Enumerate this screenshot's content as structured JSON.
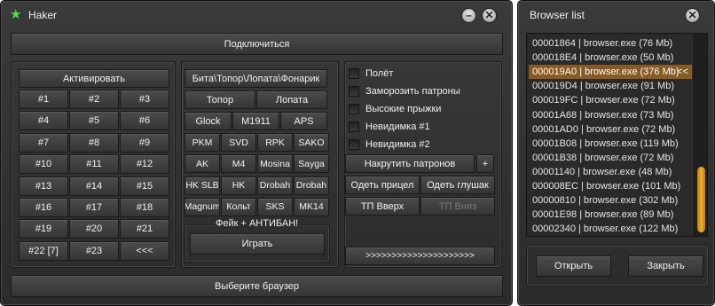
{
  "main_window": {
    "title": "Haker",
    "minimize_glyph": "–",
    "close_glyph": "✕",
    "connect_label": "Подключиться",
    "choose_browser_label": "Выберите браузер"
  },
  "left_panel": {
    "activate_label": "Активировать",
    "numbers": [
      "#1",
      "#2",
      "#3",
      "#4",
      "#5",
      "#6",
      "#7",
      "#8",
      "#9",
      "#10",
      "#11",
      "#12",
      "#13",
      "#14",
      "#15",
      "#16",
      "#17",
      "#18",
      "#19",
      "#20",
      "#21",
      "#22 [7]",
      "#23",
      "<<<"
    ]
  },
  "weapons_panel": {
    "melee_label": "Бита\\Топор\\Лопата\\Фонарик",
    "axe_label": "Топор",
    "shovel_label": "Лопата",
    "guns": [
      "Glock",
      "M1911",
      "APS",
      "PKM",
      "SVD",
      "RPK",
      "SAKO",
      "AK",
      "M4",
      "Mosina",
      "Sayga",
      "HK SLB",
      "HK",
      "Drobah",
      "Drobah",
      "Magnum",
      "Кольт",
      "SKS",
      "MK14"
    ],
    "fake_label": "Фейк + АНТИБАН!",
    "play_label": "Играть"
  },
  "options_panel": {
    "checkboxes": [
      "Полёт",
      "Заморозить патроны",
      "Высокие прыжки",
      "Невидимка #1",
      "Невидимка #2"
    ],
    "ammo_label": "Накрутить патронов",
    "plus_label": "+",
    "scope_label": "Одеть прицел",
    "silencer_label": "Одеть глушак",
    "tp_up_label": "ТП Вверх",
    "tp_down_label": "ТП Вниз",
    "arrows_label": ">>>>>>>>>>>>>>>>>>>>>"
  },
  "browser_window": {
    "title": "Browser list",
    "close_glyph": "✕",
    "items": [
      "00001864 | browser.exe (76 Mb)",
      "000018E4 | browser.exe (50 Mb)",
      "000019A0 | browser.exe (376 Mb)",
      "000019D4 | browser.exe (91 Mb)",
      "000019FC | browser.exe (72 Mb)",
      "00001A68 | browser.exe (73 Mb)",
      "00001AD0 | browser.exe (72 Mb)",
      "00001B08 | browser.exe (119 Mb)",
      "00001B38 | browser.exe (72 Mb)",
      "00001140 | browser.exe (48 Mb)",
      "000008EC | browser.exe (101 Mb)",
      "00000810 | browser.exe (302 Mb)",
      "00001E98 | browser.exe (89 Mb)",
      "00002340 | browser.exe (122 Mb)"
    ],
    "selected_index": 2,
    "selected_marker": "<<",
    "open_label": "Открыть",
    "close_label": "Закрыть"
  },
  "colors": {
    "accent": "#8a5a24",
    "scroll_thumb": "#f0b12a",
    "window_bg": "#2f2f2f"
  }
}
